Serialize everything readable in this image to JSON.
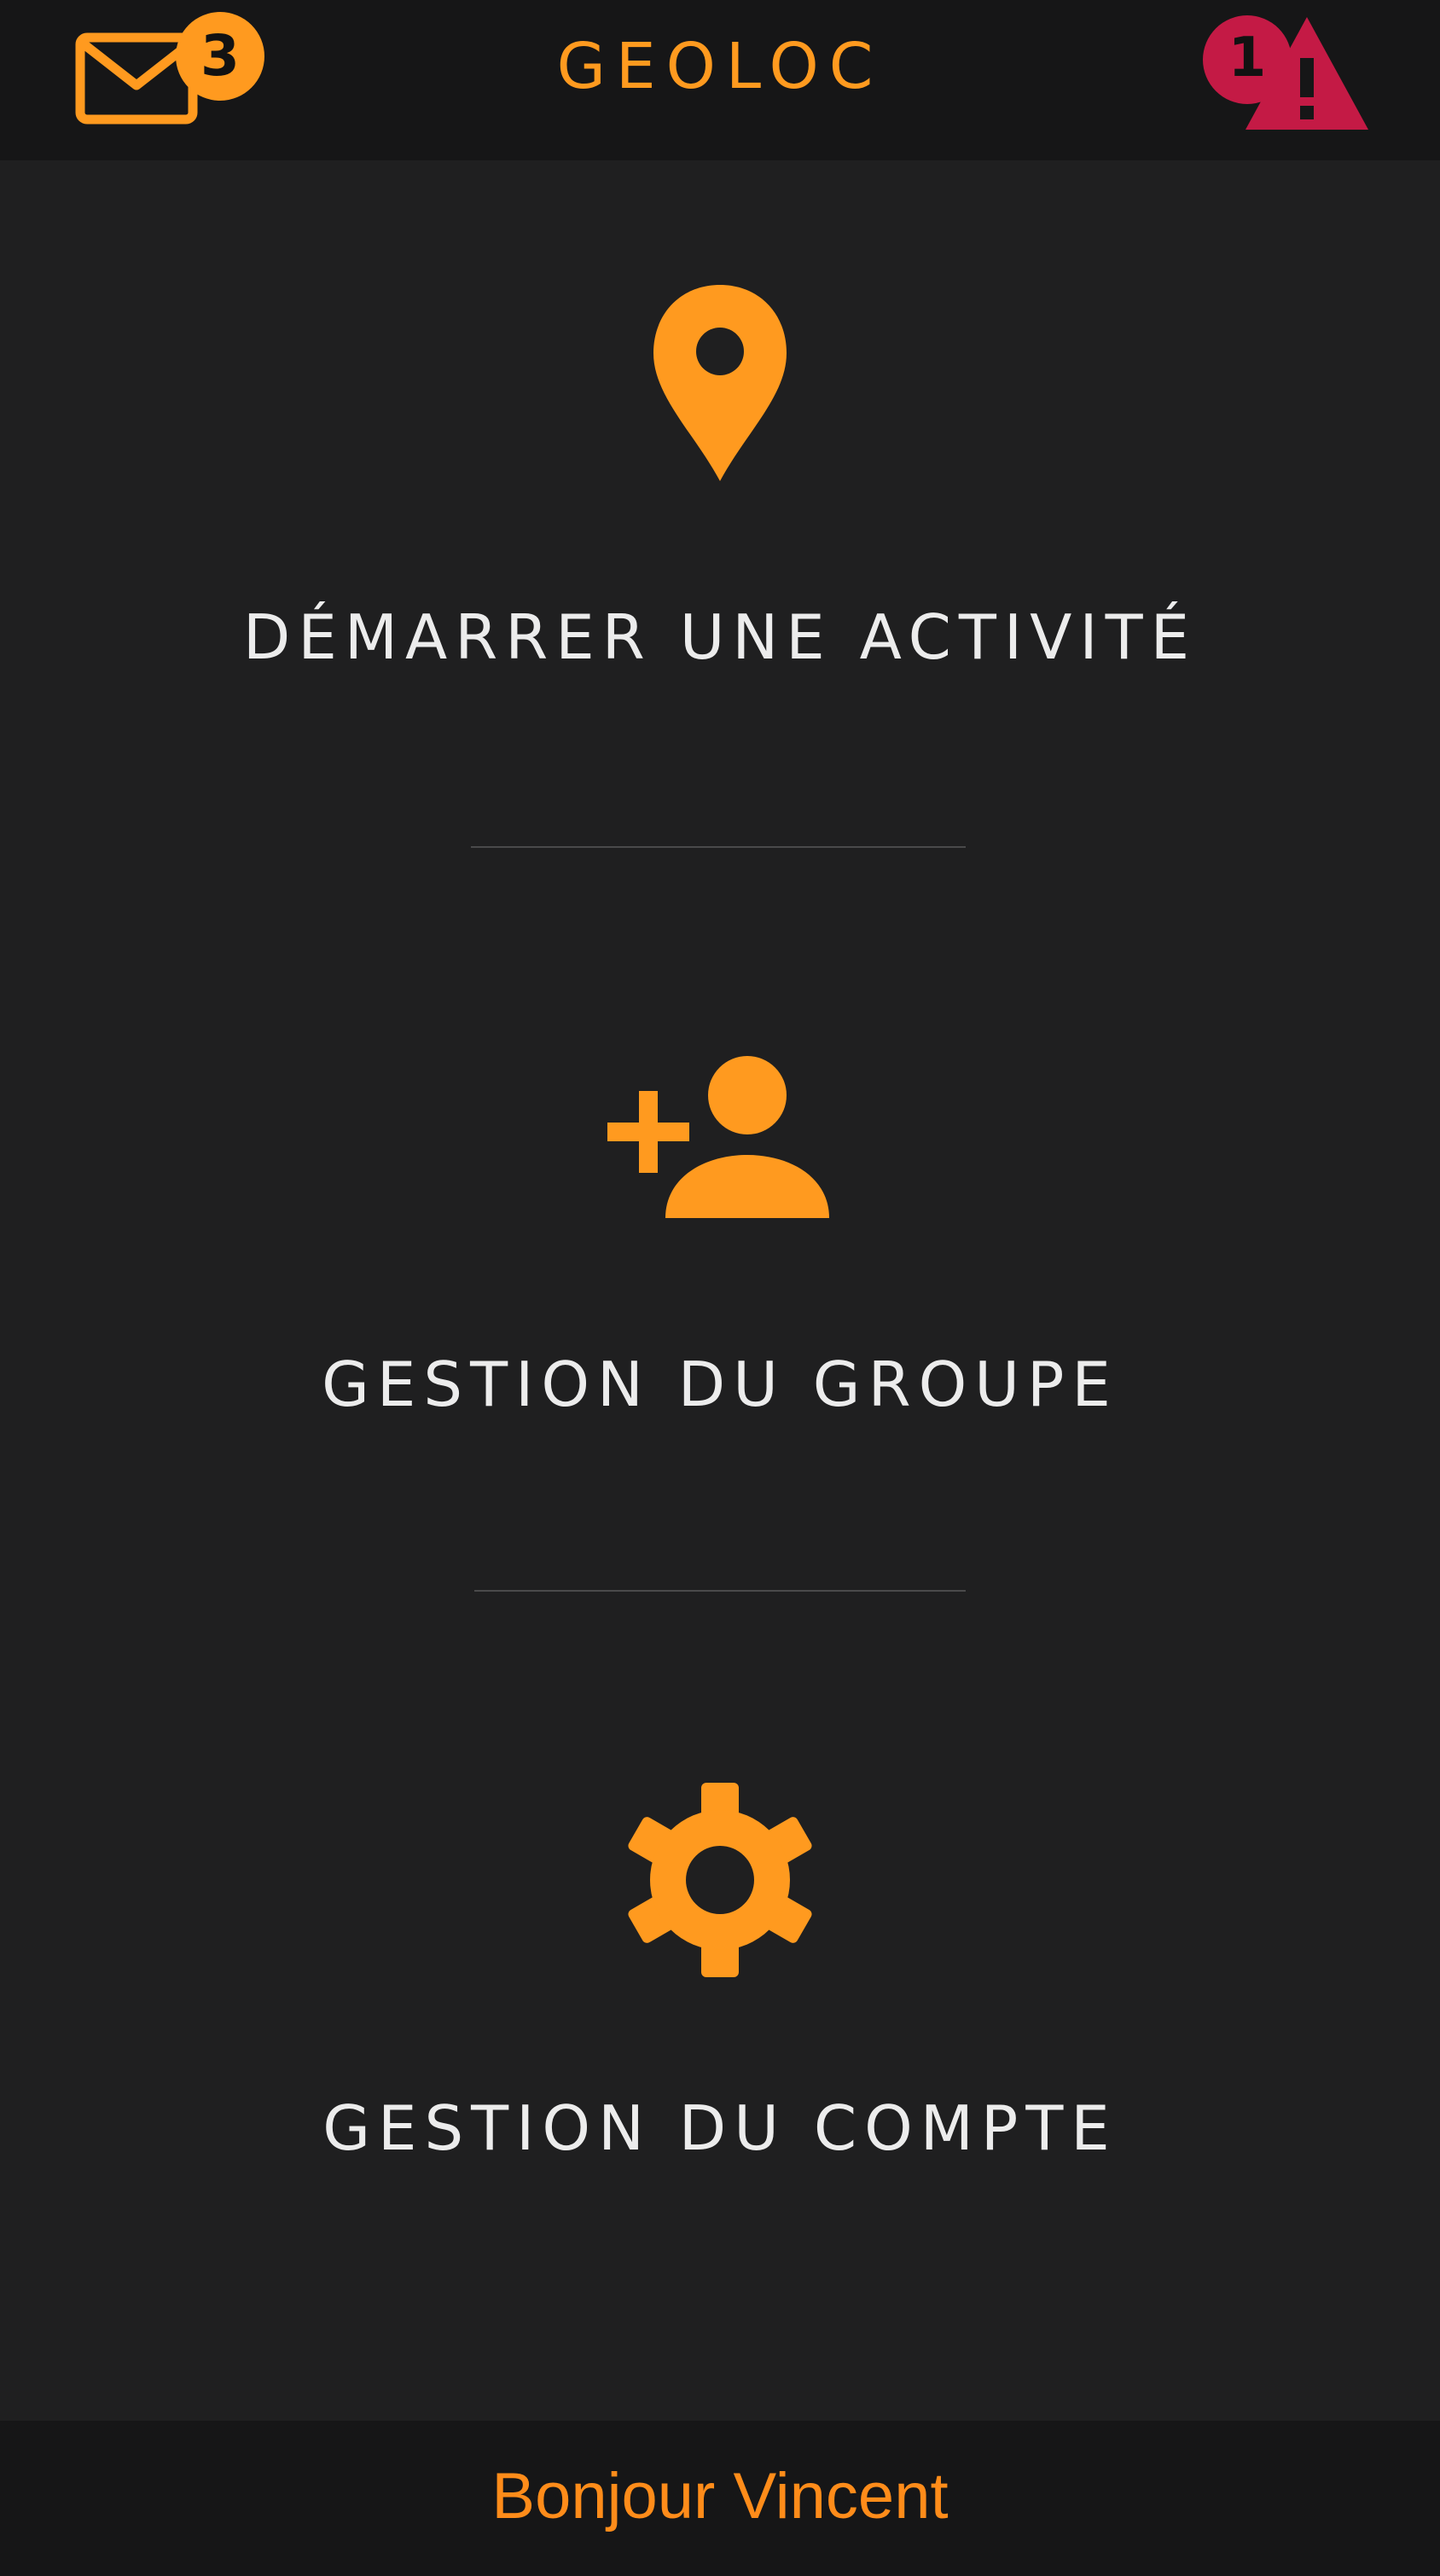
{
  "header": {
    "title": "GEOLOC",
    "mail": {
      "icon": "mail-icon",
      "unread_count": "3"
    },
    "alerts": {
      "icon": "warning-icon",
      "count": "1"
    }
  },
  "menu": {
    "items": [
      {
        "label": "DÉMARRER UNE ACTIVITÉ",
        "icon": "map-pin-icon"
      },
      {
        "label": "GESTION DU GROUPE",
        "icon": "add-user-icon"
      },
      {
        "label": "GESTION DU COMPTE",
        "icon": "gear-icon"
      }
    ]
  },
  "footer": {
    "greeting": "Bonjour Vincent"
  },
  "colors": {
    "accent": "#ff9a1f",
    "alert": "#c41a45",
    "background": "#1f1f20",
    "bar": "#161617",
    "text": "#ececec"
  }
}
